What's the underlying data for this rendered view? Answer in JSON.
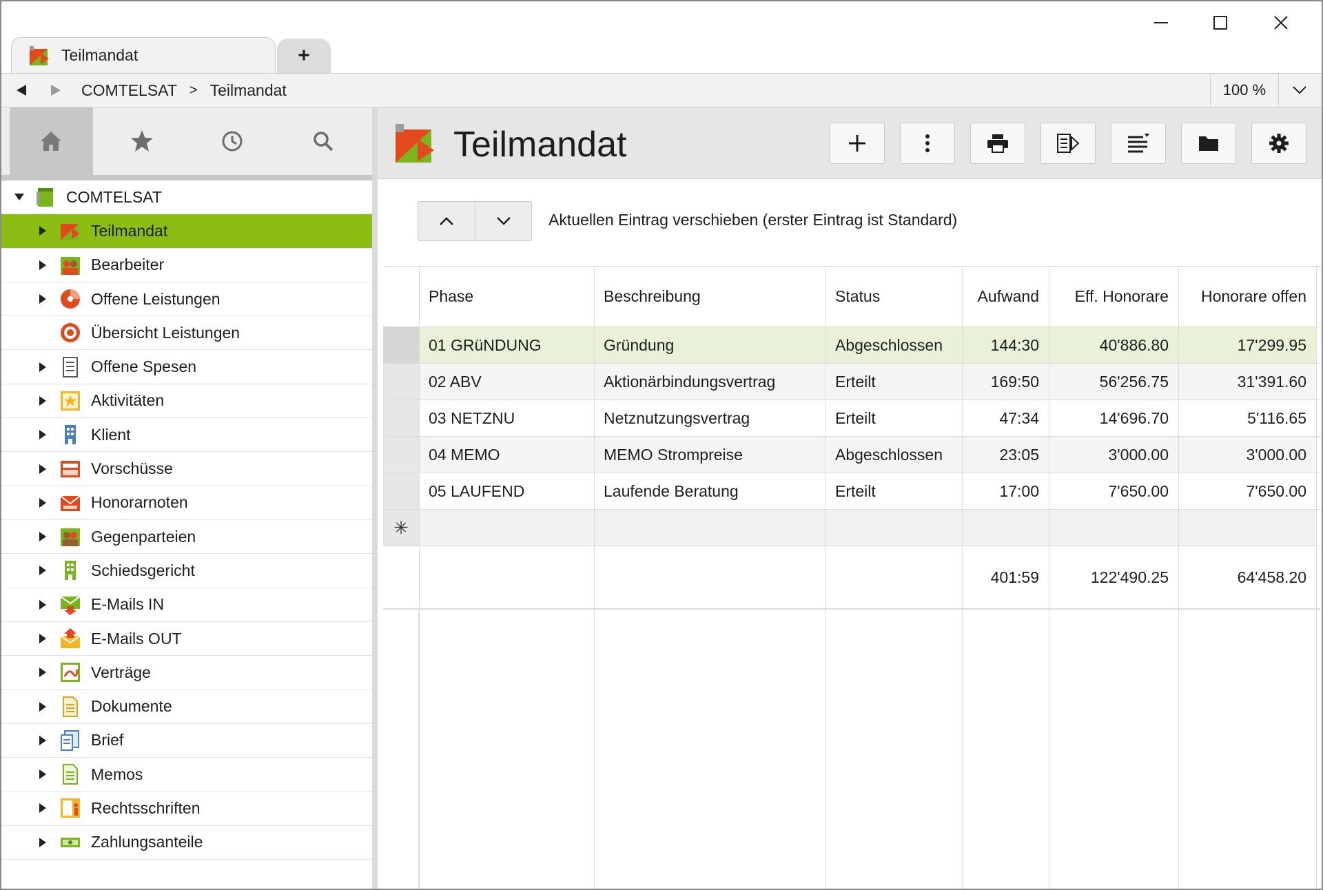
{
  "window": {
    "tab_title": "Teilmandat",
    "new_tab_label": "+"
  },
  "addressbar": {
    "crumbs": [
      "COMTELSAT",
      "Teilmandat"
    ],
    "separator": ">",
    "zoom": "100 %"
  },
  "sidebar": {
    "tabs": [
      "home-icon",
      "star-icon",
      "clock-icon",
      "search-icon"
    ],
    "root": {
      "label": "COMTELSAT"
    },
    "items": [
      {
        "label": "Teilmandat",
        "expandable": true,
        "selected": true
      },
      {
        "label": "Bearbeiter",
        "expandable": true
      },
      {
        "label": "Offene Leistungen",
        "expandable": true
      },
      {
        "label": "Übersicht Leistungen",
        "expandable": false
      },
      {
        "label": "Offene Spesen",
        "expandable": true
      },
      {
        "label": "Aktivitäten",
        "expandable": true
      },
      {
        "label": "Klient",
        "expandable": true
      },
      {
        "label": "Vorschüsse",
        "expandable": true
      },
      {
        "label": "Honorarnoten",
        "expandable": true
      },
      {
        "label": "Gegenparteien",
        "expandable": true
      },
      {
        "label": "Schiedsgericht",
        "expandable": true
      },
      {
        "label": "E-Mails IN",
        "expandable": true
      },
      {
        "label": "E-Mails OUT",
        "expandable": true
      },
      {
        "label": "Verträge",
        "expandable": true
      },
      {
        "label": "Dokumente",
        "expandable": true
      },
      {
        "label": "Brief",
        "expandable": true
      },
      {
        "label": "Memos",
        "expandable": true
      },
      {
        "label": "Rechtsschriften",
        "expandable": true
      },
      {
        "label": "Zahlungsanteile",
        "expandable": true
      }
    ]
  },
  "main": {
    "title": "Teilmandat",
    "toolbar": [
      "add-icon",
      "more-icon",
      "print-icon",
      "export-icon",
      "sort-icon",
      "folder-icon",
      "gear-icon"
    ],
    "mover_text": "Aktuellen Eintrag verschieben (erster Eintrag ist Standard)"
  },
  "grid": {
    "columns": [
      "Phase",
      "Beschreibung",
      "Status",
      "Aufwand",
      "Eff. Honorare",
      "Honorare offen"
    ],
    "rows": [
      [
        "01 GRüNDUNG",
        "Gründung",
        "Abgeschlossen",
        "144:30",
        "40'886.80",
        "17'299.95"
      ],
      [
        "02 ABV",
        "Aktionärbindungsvertrag",
        "Erteilt",
        "169:50",
        "56'256.75",
        "31'391.60"
      ],
      [
        "03 NETZNU",
        "Netznutzungsvertrag",
        "Erteilt",
        "47:34",
        "14'696.70",
        "5'116.65"
      ],
      [
        "04 MEMO",
        "MEMO Strompreise",
        "Abgeschlossen",
        "23:05",
        "3'000.00",
        "3'000.00"
      ],
      [
        "05 LAUFEND",
        "Laufende Beratung",
        "Erteilt",
        "17:00",
        "7'650.00",
        "7'650.00"
      ]
    ],
    "new_row_marker": "✳",
    "totals": [
      "",
      "",
      "",
      "401:59",
      "122'490.25",
      "64'458.20"
    ]
  }
}
